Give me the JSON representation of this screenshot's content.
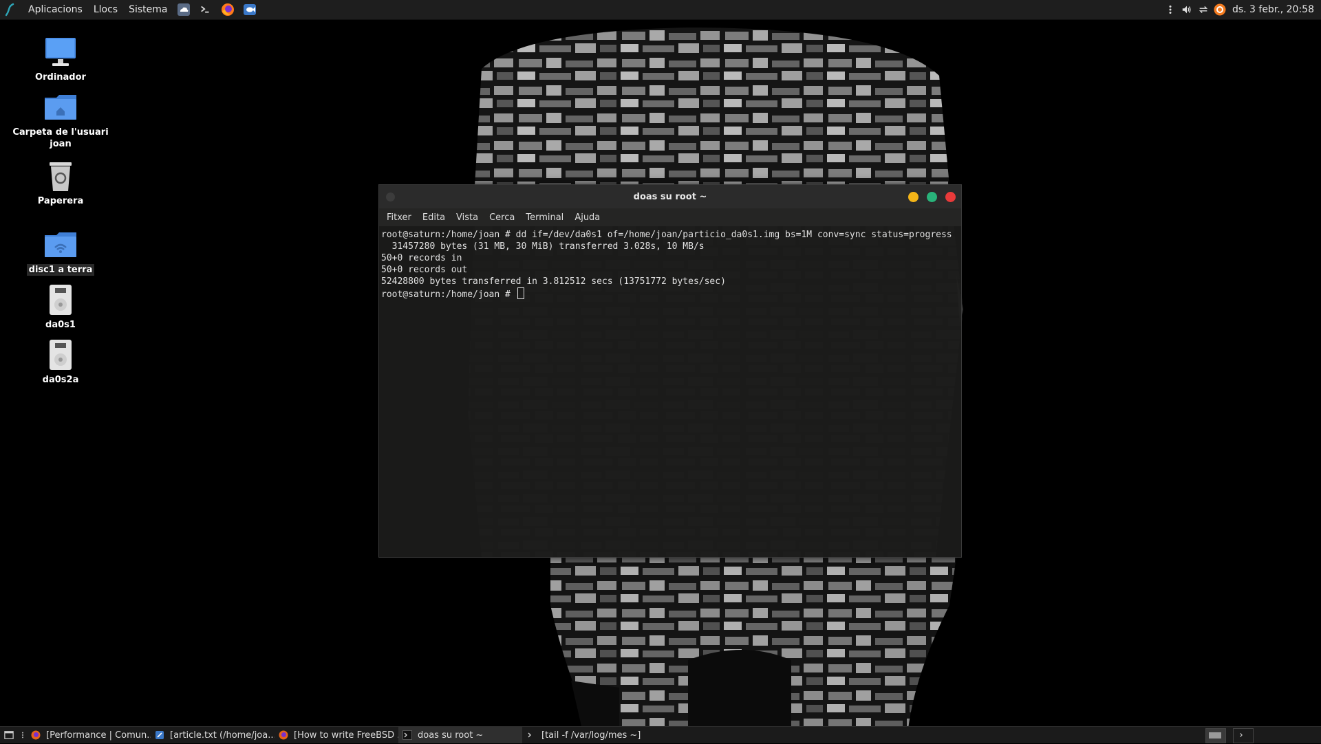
{
  "top_panel": {
    "menus": [
      "Aplicacions",
      "Llocs",
      "Sistema"
    ],
    "launchers": [
      "cloud-icon",
      "terminal-icon",
      "firefox-icon",
      "fish-icon"
    ],
    "tray_icons": [
      "dots-icon",
      "volume-icon",
      "network-icon",
      "update-icon"
    ],
    "clock": "ds. 3 febr., 20:58"
  },
  "desktop_icons": [
    {
      "label": "Ordinador",
      "icon": "computer-icon"
    },
    {
      "label": "Carpeta de l'usuari joan",
      "icon": "home-folder-icon"
    },
    {
      "label": "Paperera",
      "icon": "trash-icon"
    },
    {
      "label": "disc1 a terra",
      "icon": "network-folder-icon"
    },
    {
      "label": "da0s1",
      "icon": "drive-icon"
    },
    {
      "label": "da0s2a",
      "icon": "drive-icon"
    }
  ],
  "terminal": {
    "title": "doas su root ~",
    "menus": [
      "Fitxer",
      "Edita",
      "Vista",
      "Cerca",
      "Terminal",
      "Ajuda"
    ],
    "lines": [
      "root@saturn:/home/joan # dd if=/dev/da0s1 of=/home/joan/particio_da0s1.img bs=1M conv=sync status=progress",
      "  31457280 bytes (31 MB, 30 MiB) transferred 3.028s, 10 MB/s",
      "50+0 records in",
      "50+0 records out",
      "52428800 bytes transferred in 3.812512 secs (13751772 bytes/sec)"
    ],
    "prompt": "root@saturn:/home/joan # "
  },
  "taskbar": {
    "tasks": [
      {
        "label": "[Performance | Comun...",
        "icon": "firefox-icon",
        "active": false
      },
      {
        "label": "[article.txt (/home/joa...",
        "icon": "editor-icon",
        "active": false
      },
      {
        "label": "[How to write FreeBSD ...",
        "icon": "firefox-icon",
        "active": false
      },
      {
        "label": "doas su root ~",
        "icon": "terminal-icon",
        "active": true
      },
      {
        "label": "[tail -f /var/log/mes ~]",
        "icon": "terminal-icon",
        "active": false
      }
    ]
  },
  "colors": {
    "panel": "#1e1e1e",
    "minimize": "#f4b518",
    "maximize": "#29b37a",
    "close": "#e93a3a"
  }
}
